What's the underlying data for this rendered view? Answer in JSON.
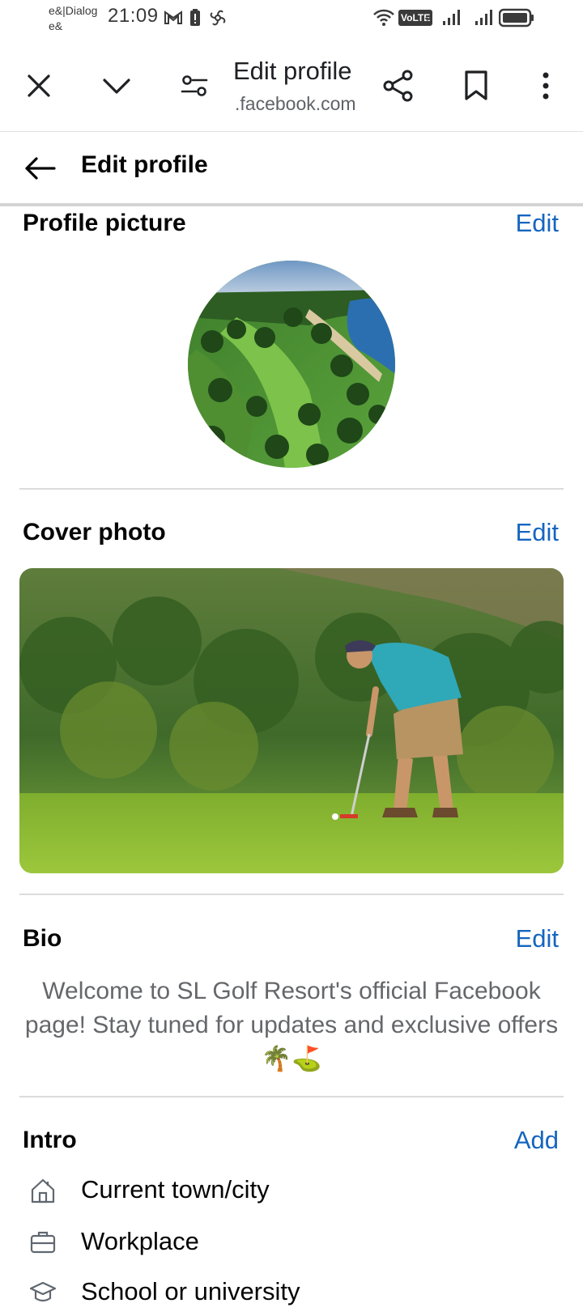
{
  "status_bar": {
    "carrier_line1": "e&|Dialog",
    "carrier_line2": "e&",
    "time": "21:09",
    "volte_label": "VoLTE",
    "sim_index": "2",
    "icons": [
      "gmail-icon",
      "battery-saver-icon",
      "pinwheel-icon",
      "wifi-icon",
      "volte-icon",
      "signal-sim1-icon",
      "signal-sim2-icon",
      "battery-icon"
    ]
  },
  "browser_toolbar": {
    "title": "Edit profile",
    "url": ".facebook.com",
    "icons": [
      "close-icon",
      "chevron-down-icon",
      "settings-sliders-icon",
      "share-icon",
      "bookmark-icon",
      "more-vert-icon"
    ]
  },
  "header": {
    "title": "Edit profile",
    "back_icon": "arrow-left-icon"
  },
  "sections": {
    "profile_picture": {
      "title": "Profile picture",
      "action": "Edit"
    },
    "cover_photo": {
      "title": "Cover photo",
      "action": "Edit"
    },
    "bio": {
      "title": "Bio",
      "action": "Edit",
      "text": "Welcome to SL Golf Resort's official Facebook page! Stay tuned for updates and exclusive offers🌴⛳"
    },
    "intro": {
      "title": "Intro",
      "action": "Add",
      "items": [
        {
          "label": "Current town/city",
          "icon": "home-icon"
        },
        {
          "label": "Workplace",
          "icon": "briefcase-icon"
        },
        {
          "label": "School or university",
          "icon": "graduation-cap-icon"
        }
      ]
    }
  },
  "colors": {
    "link_blue": "#1565c0",
    "muted_text": "#65676b",
    "divider": "#dcdcdc"
  }
}
